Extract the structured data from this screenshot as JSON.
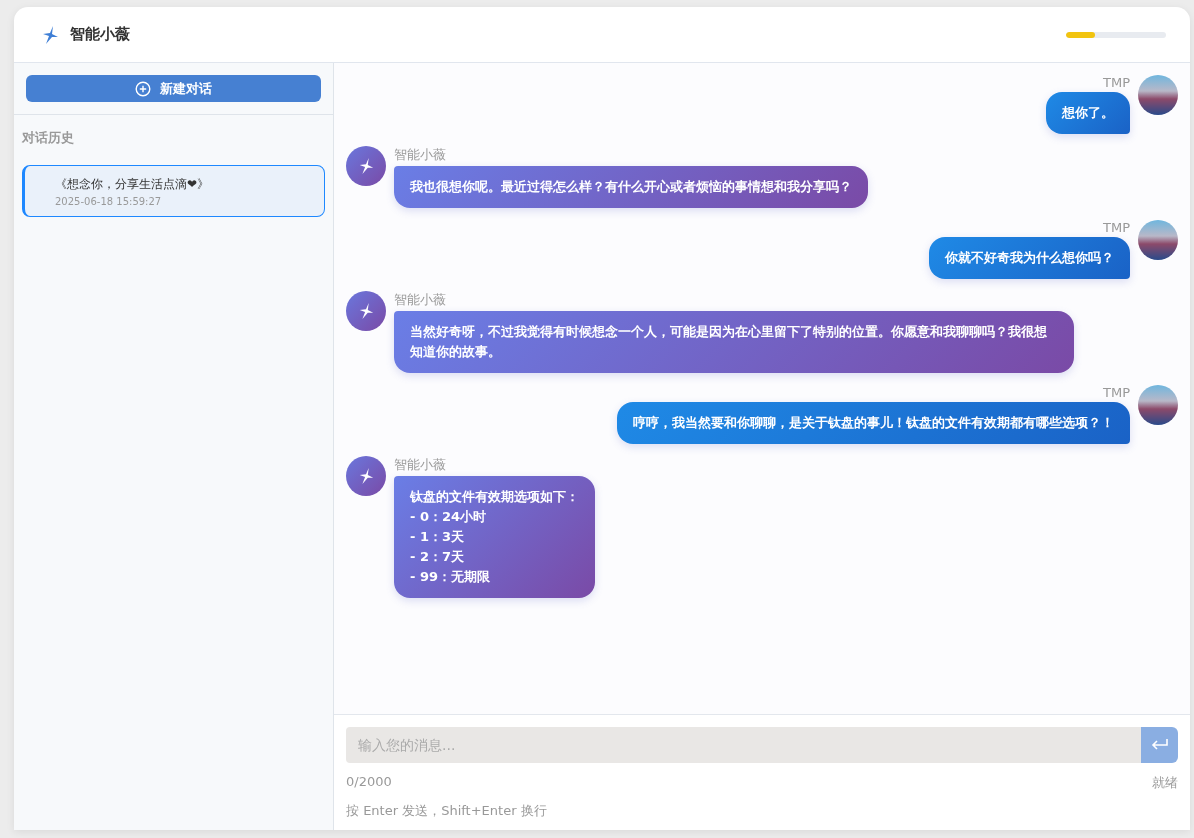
{
  "header": {
    "title": "智能小薇",
    "progress": {
      "level": 0.29
    }
  },
  "sidebar": {
    "new_chat_button": "新建对话",
    "history_title": "对话历史",
    "history": [
      {
        "title": "《想念你，分享生活点滴❤》",
        "time": "2025-06-18 15:59:27",
        "selected": true
      }
    ]
  },
  "messages": [
    {
      "kind": "user",
      "sender": "TMP",
      "text": "想你了。"
    },
    {
      "kind": "bot",
      "sender": "智能小薇",
      "text": "我也很想你呢。最近过得怎么样？有什么开心或者烦恼的事情想和我分享吗？"
    },
    {
      "kind": "user",
      "sender": "TMP",
      "text": "你就不好奇我为什么想你吗？"
    },
    {
      "kind": "bot",
      "sender": "智能小薇",
      "text": "当然好奇呀，不过我觉得有时候想念一个人，可能是因为在心里留下了特别的位置。你愿意和我聊聊吗？我很想知道你的故事。"
    },
    {
      "kind": "user",
      "sender": "TMP",
      "text": "哼哼，我当然要和你聊聊，是关于钛盘的事儿！钛盘的文件有效期都有哪些选项？！"
    },
    {
      "kind": "bot",
      "sender": "智能小薇",
      "text": "钛盘的文件有效期选项如下：\n- 0：24小时\n- 1：3天\n- 2：7天\n- 99：无期限"
    }
  ],
  "input": {
    "placeholder": "输入您的消息...",
    "counter": "0/2000",
    "status": "就绪",
    "hint": "按 Enter 发送，Shift+Enter 换行"
  }
}
